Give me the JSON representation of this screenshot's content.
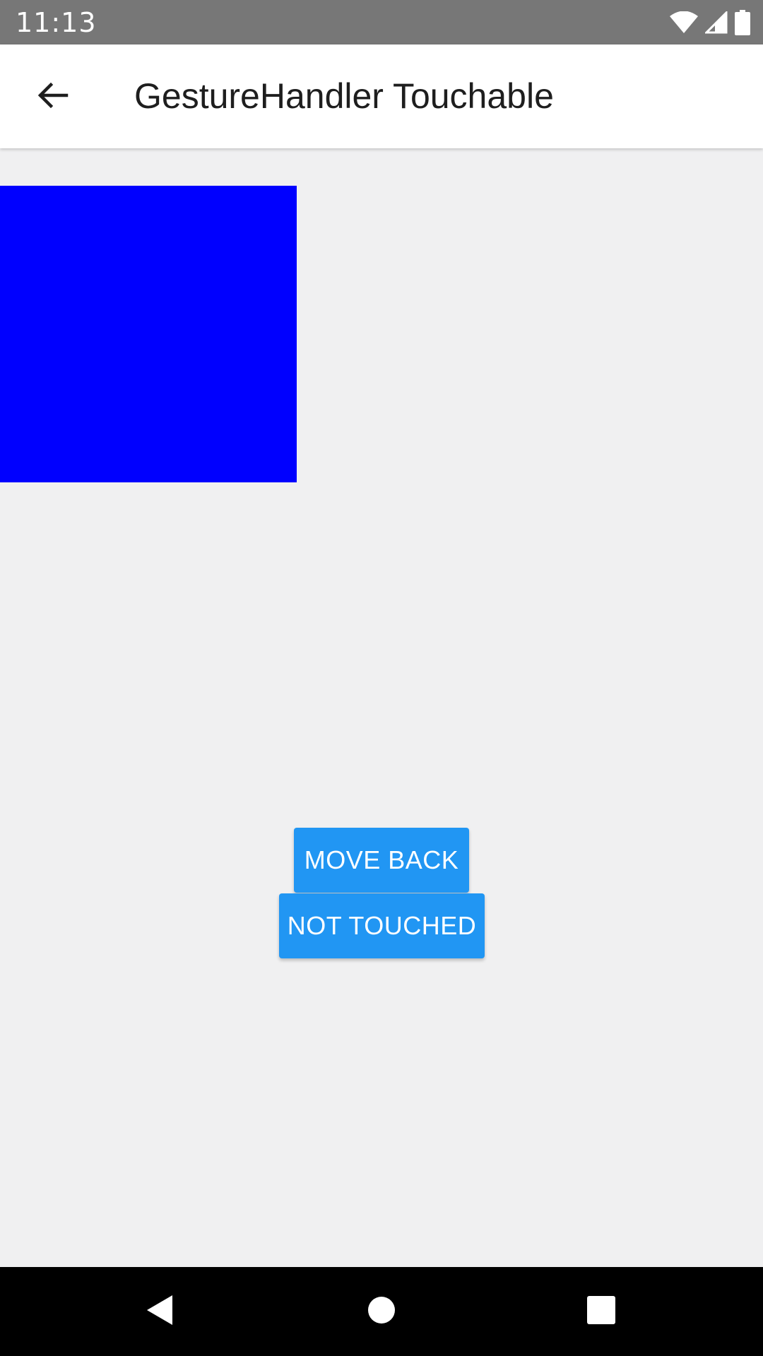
{
  "status_bar": {
    "time": "11:13",
    "icons": [
      "wifi-icon",
      "cellular-signal-icon",
      "battery-icon"
    ]
  },
  "app_bar": {
    "back_icon": "arrow-back-icon",
    "title": "GestureHandler Touchable"
  },
  "content": {
    "box_color": "#0000ff",
    "move_back_label": "MOVE BACK",
    "touch_state_label": "NOT TOUCHED",
    "button_color": "#2196f3"
  },
  "nav_bar": {
    "buttons": [
      "back-triangle-icon",
      "home-circle-icon",
      "recents-square-icon"
    ]
  }
}
